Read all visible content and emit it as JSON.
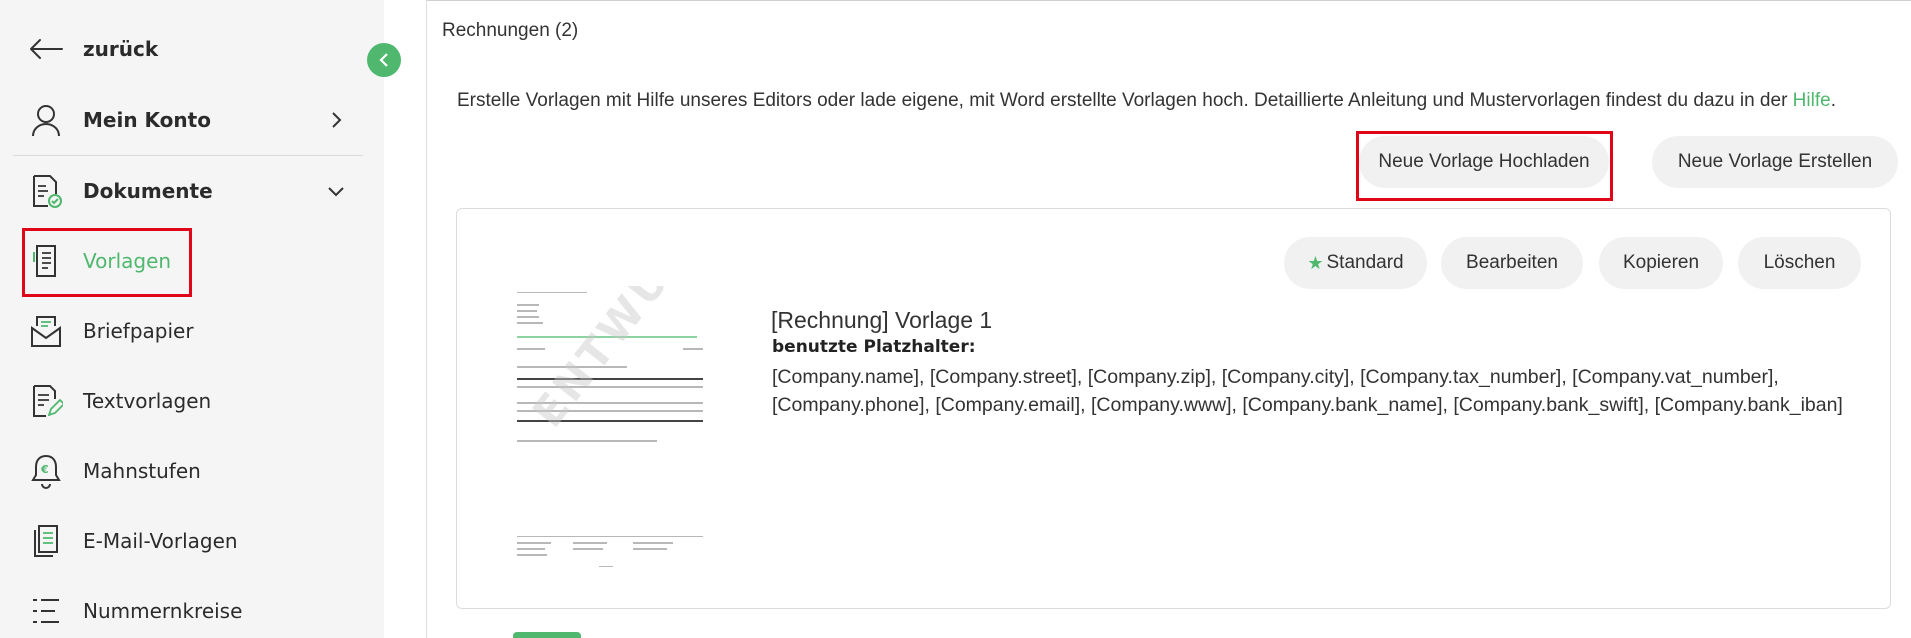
{
  "sidebar": {
    "back_label": "zurück",
    "account_label": "Mein Konto",
    "documents_label": "Dokumente",
    "items": [
      {
        "label": "Vorlagen"
      },
      {
        "label": "Briefpapier"
      },
      {
        "label": "Textvorlagen"
      },
      {
        "label": "Mahnstufen"
      },
      {
        "label": "E-Mail-Vorlagen"
      },
      {
        "label": "Nummernkreise"
      }
    ]
  },
  "main": {
    "heading": "Rechnungen (2)",
    "info_text": "Erstelle Vorlagen mit Hilfe unseres Editors oder lade eigene, mit Word erstellte Vorlagen hoch. Detaillierte Anleitung und Mustervorlagen findest du dazu in der ",
    "help_link": "Hilfe",
    "info_end": ".",
    "upload_button": "Neue Vorlage Hochladen",
    "create_button": "Neue Vorlage Erstellen"
  },
  "template_card": {
    "title": "[Rechnung] Vorlage 1",
    "placeholder_label": "benutzte Platzhalter:",
    "placeholders": "[Company.name], [Company.street], [Company.zip], [Company.city], [Company.tax_number], [Company.vat_number], [Company.phone], [Company.email], [Company.www], [Company.bank_name], [Company.bank_swift], [Company.bank_iban]",
    "standard_button": "Standard",
    "edit_button": "Bearbeiten",
    "copy_button": "Kopieren",
    "delete_button": "Löschen",
    "watermark": "ENTWURF"
  },
  "colors": {
    "accent": "#4fb86e",
    "highlight": "#e0061a",
    "sidebar_bg": "#f5f5f5"
  }
}
